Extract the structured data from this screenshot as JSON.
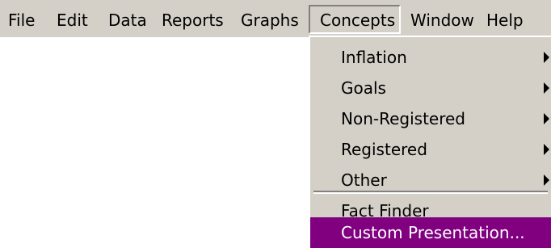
{
  "menubar": {
    "items": [
      {
        "label": "File"
      },
      {
        "label": "Edit"
      },
      {
        "label": "Data"
      },
      {
        "label": "Reports"
      },
      {
        "label": "Graphs"
      },
      {
        "label": "Concepts"
      },
      {
        "label": "Window"
      },
      {
        "label": "Help"
      }
    ],
    "active": "Concepts"
  },
  "concepts_menu": {
    "items": [
      {
        "label": "Inflation",
        "has_submenu": true
      },
      {
        "label": "Goals",
        "has_submenu": true
      },
      {
        "label": "Non-Registered",
        "has_submenu": true
      },
      {
        "label": "Registered",
        "has_submenu": true
      },
      {
        "label": "Other",
        "has_submenu": true
      },
      {
        "label": "Fact Finder",
        "has_submenu": false
      },
      {
        "label": "Custom Presentation...",
        "has_submenu": false,
        "highlighted": true
      }
    ]
  },
  "colors": {
    "menu_background": "#d4d0c8",
    "highlight_background": "#800080",
    "highlight_text": "#ffffff"
  },
  "icons": {
    "submenu_arrow": "chevron-right-icon"
  }
}
